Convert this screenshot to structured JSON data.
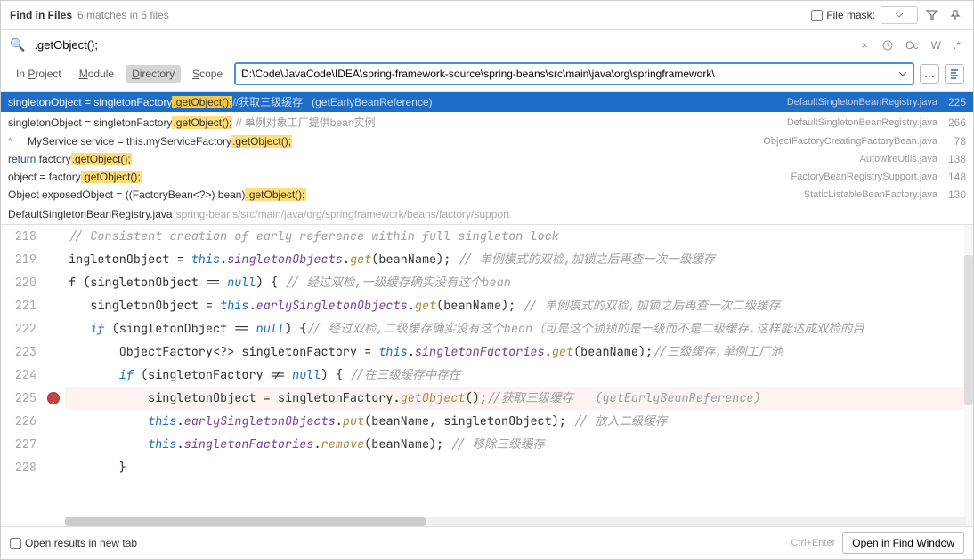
{
  "header": {
    "title": "Find in Files",
    "sub": "6 matches in 5 files",
    "filemask": "File mask:"
  },
  "search": {
    "query": ".getObject();"
  },
  "scope": {
    "p": "In Project",
    "m": "Module",
    "d": "Directory",
    "s": "Scope",
    "dir": "D:\\Code\\JavaCode\\IDEA\\spring-framework-source\\spring-beans\\src\\main\\java\\org\\springframework\\"
  },
  "results": [
    {
      "pre": "singletonObject = singletonFactory",
      "hl": ".getObject();",
      "post": "//获取三级缓存   (getEarlyBeanReference)",
      "file": "DefaultSingletonBeanRegistry.java",
      "line": "225",
      "sel": true
    },
    {
      "pre": "singletonObject = singletonFactory",
      "hl": ".getObject();",
      "post": " // 单例对象工厂提供bean实例",
      "file": "DefaultSingletonBeanRegistry.java",
      "line": "266"
    },
    {
      "star": "*",
      "pre": "   MyService service = this.myServiceFactory",
      "hl": ".getObject();",
      "post": "",
      "file": "ObjectFactoryCreatingFactoryBean.java",
      "line": "78"
    },
    {
      "pre": "return factory",
      "hl": ".getObject();",
      "post": "",
      "kw": "return ",
      "file": "AutowireUtils.java",
      "line": "138"
    },
    {
      "pre": "object = factory",
      "hl": ".getObject();",
      "post": "",
      "file": "FactoryBeanRegistrySupport.java",
      "line": "148"
    },
    {
      "pre": "Object exposedObject = ((FactoryBean<?>) bean)",
      "hl": ".getObject();",
      "post": "",
      "file": "StaticListableBeanFactory.java",
      "line": "130"
    }
  ],
  "bc": {
    "file": "DefaultSingletonBeanRegistry.java",
    "path": "spring-beans/src/main/java/org/springframework/beans/factory/support"
  },
  "gutter": [
    "218",
    "219",
    "220",
    "221",
    "222",
    "223",
    "224",
    "225",
    "226",
    "227",
    "228"
  ],
  "code": [
    "// Consistent creation of early reference within full singleton lock",
    "ingletonObject = this.singletonObjects.get(beanName); // 单例模式的双检,加锁之后再查一次一级缓存",
    "f (singletonObject == null) { // 经过双检,一级缓存确实没有这个bean",
    "   singletonObject = this.earlySingletonObjects.get(beanName); // 单例模式的双检,加锁之后再查一次二级缓存",
    "   if (singletonObject == null) {// 经过双检,二级缓存确实没有这个bean（可是这个锁锁的是一级而不是二级缓存,这样能达成双检的目",
    "       ObjectFactory<?> singletonFactory = this.singletonFactories.get(beanName);//三级缓存,单例工厂池",
    "       if (singletonFactory != null) { //在三级缓存中存在",
    "           singletonObject = singletonFactory.getObject();//获取三级缓存   (getEarlyBeanReference)",
    "           this.earlySingletonObjects.put(beanName, singletonObject); // 放入二级缓存",
    "           this.singletonFactories.remove(beanName); // 移除三级缓存",
    "       }"
  ],
  "footer": {
    "chk": "Open results in new tab",
    "hint": "Ctrl+Enter",
    "btn": "Open in Find Window"
  }
}
